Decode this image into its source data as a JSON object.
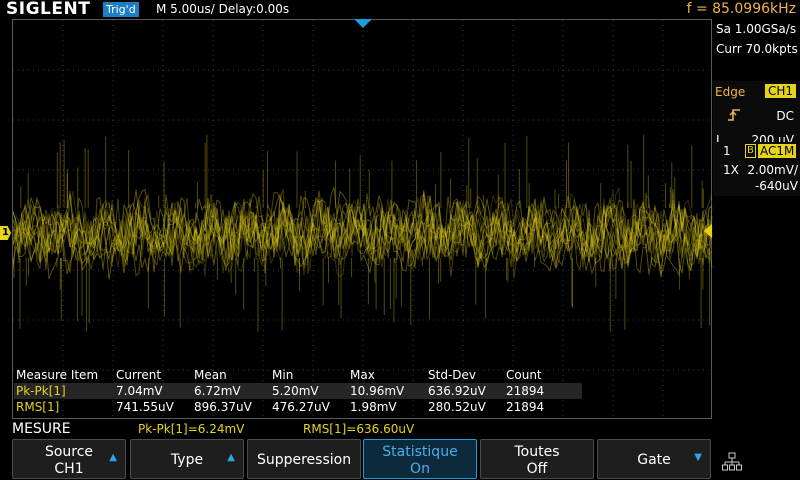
{
  "header": {
    "logo": "SIGLENT",
    "trigger_status": "Trig'd",
    "timebase": "M 5.00us/  Delay:0.00s",
    "frequency": "f = 85.0996kHz"
  },
  "acquisition": {
    "sample_rate": "Sa 1.00GSa/s",
    "curr_points": "Curr 70.0kpts"
  },
  "trigger": {
    "type": "Edge",
    "source": "CH1",
    "coupling": "DC",
    "slope_icon": "rising-edge-icon",
    "level_label": "L",
    "level": "200 uV"
  },
  "channel": {
    "number": "1",
    "bw_flag": "B",
    "coupling": "AC1M",
    "probe": "1X",
    "scale": "2.00mV/",
    "offset": "-640uV",
    "marker": "1"
  },
  "measure": {
    "headers": [
      "Measure Item",
      "Current",
      "Mean",
      "Min",
      "Max",
      "Std-Dev",
      "Count"
    ],
    "rows": [
      [
        "Pk-Pk[1]",
        "7.04mV",
        "6.72mV",
        "5.20mV",
        "10.96mV",
        "636.92uV",
        "21894"
      ],
      [
        "RMS[1]",
        "741.55uV",
        "896.37uV",
        "476.27uV",
        "1.98mV",
        "280.52uV",
        "21894"
      ]
    ]
  },
  "bottom": {
    "menu_title": "MESURE",
    "quick_pkpk": "Pk-Pk[1]=6.24mV",
    "quick_rms": "RMS[1]=636.60uV"
  },
  "softkeys": [
    {
      "line1": "Source",
      "line2": "CH1",
      "arrow": "up"
    },
    {
      "line1": "Type",
      "line2": "",
      "arrow": "up"
    },
    {
      "line1": "Supperession",
      "line2": "",
      "arrow": ""
    },
    {
      "line1": "Statistique",
      "line2": "On",
      "arrow": ""
    },
    {
      "line1": "Toutes",
      "line2": "Off",
      "arrow": ""
    },
    {
      "line1": "Gate",
      "line2": "",
      "arrow": "down"
    }
  ],
  "colors": {
    "trace": "#e6d41a",
    "accent": "#1e9bd8",
    "frequency": "#f0b24a",
    "grid": "#3a3a3a"
  }
}
